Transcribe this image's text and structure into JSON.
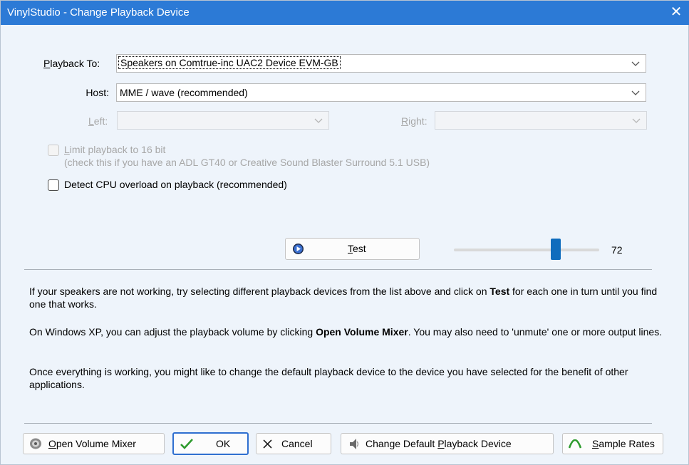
{
  "window": {
    "title": "VinylStudio - Change Playback Device",
    "close_glyph": "✕"
  },
  "playback": {
    "label_prefix": "P",
    "label_rest": "layback To:",
    "value": "Speakers on Comtrue-inc UAC2 Device EVM-GB"
  },
  "host": {
    "label": "Host:",
    "value": "MME / wave (recommended)"
  },
  "left": {
    "label_prefix": "L",
    "label_rest": "eft:",
    "value": ""
  },
  "right": {
    "label_prefix": "R",
    "label_rest": "ight:",
    "value": ""
  },
  "limit16": {
    "line1_prefix": "L",
    "line1_rest": "imit playback to 16 bit",
    "line2": "(check this if you have an ADL GT40 or Creative Sound Blaster Surround 5.1 USB)",
    "checked": false,
    "enabled": false
  },
  "cpu_overload": {
    "label": "Detect CPU overload on playback (recommended)",
    "checked": false
  },
  "test_button": {
    "label_prefix": "T",
    "label_rest": "est",
    "icon": "play-circle-icon"
  },
  "volume": {
    "value_text": "72",
    "level_fraction": 0.72
  },
  "help": {
    "p1_a": "If your speakers are not working, try selecting different playback devices from the list above and click on ",
    "p1_b": "Test",
    "p1_c": " for each one in turn until you find one that works.",
    "p2_a": "On Windows XP, you can adjust the playback volume by clicking ",
    "p2_b": "Open Volume Mixer",
    "p2_c": ".  You may also need to 'unmute' one or more output lines.",
    "p3": "Once everything is working, you might like to change the default playback device to the device you have selected for the benefit of other applications."
  },
  "buttons": {
    "open_mixer": {
      "prefix": "O",
      "rest": "pen Volume Mixer",
      "icon": "speaker-icon"
    },
    "ok": {
      "label": "OK",
      "icon": "checkmark-icon"
    },
    "cancel": {
      "label": "Cancel",
      "icon": "x-icon"
    },
    "change_default": {
      "before": "Change Default ",
      "underline": "P",
      "after": "layback Device",
      "icon": "speaker-cone-icon"
    },
    "sample_rates": {
      "prefix": "S",
      "rest": "ample Rates",
      "icon": "wave-arc-icon"
    }
  },
  "colors": {
    "titlebar": "#2c7ad6",
    "client_bg": "#eef4fb",
    "accent": "#0f6cbd"
  }
}
